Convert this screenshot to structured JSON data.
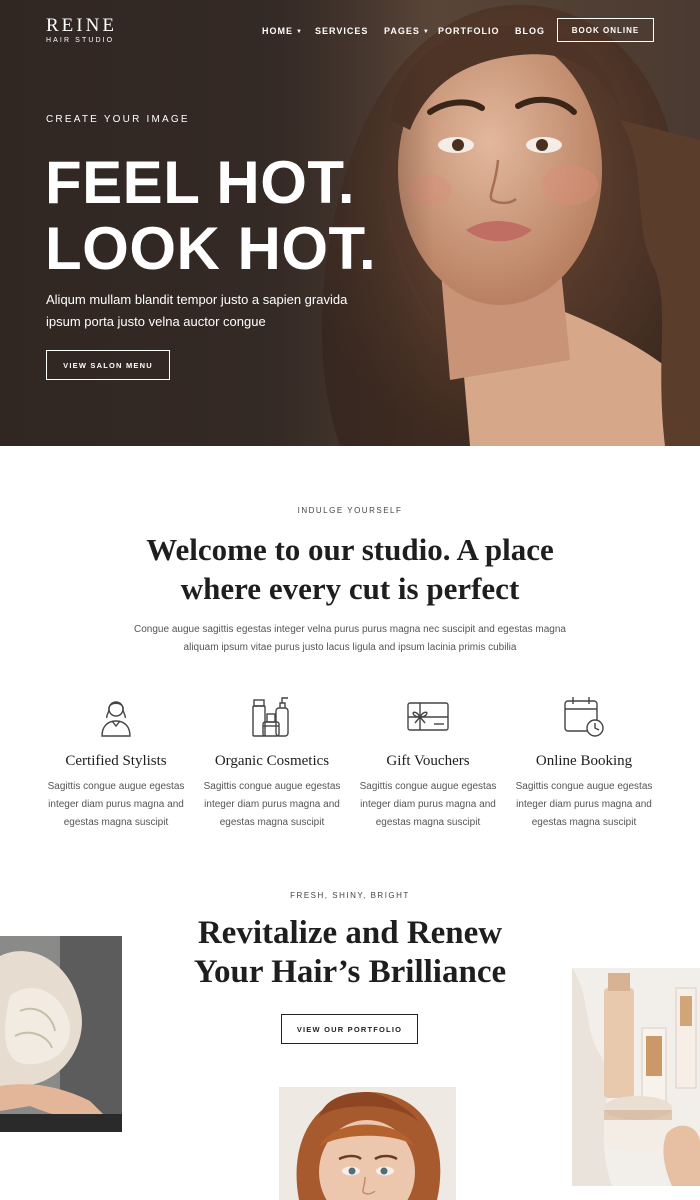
{
  "header": {
    "logo": {
      "name": "REINE",
      "tagline": "HAIR STUDIO"
    },
    "nav": [
      {
        "label": "HOME",
        "has_dropdown": true
      },
      {
        "label": "SERVICES",
        "has_dropdown": false
      },
      {
        "label": "PAGES",
        "has_dropdown": true
      },
      {
        "label": "PORTFOLIO",
        "has_dropdown": false
      },
      {
        "label": "BLOG",
        "has_dropdown": false
      }
    ],
    "cta": "BOOK ONLINE"
  },
  "hero": {
    "eyebrow": "CREATE YOUR IMAGE",
    "title_line1": "FEEL HOT.",
    "title_line2": "LOOK HOT.",
    "text": "Aliqum mullam blandit tempor justo a sapien gravida ipsum porta justo velna auctor congue",
    "button": "VIEW SALON MENU"
  },
  "welcome": {
    "eyebrow": "INDULGE YOURSELF",
    "title_line1": "Welcome to our studio. A place",
    "title_line2": "where every cut is perfect",
    "text": "Congue augue sagittis egestas integer velna purus purus magna nec suscipit and egestas magna aliquam ipsum vitae purus justo lacus ligula and ipsum lacinia primis cubilia"
  },
  "features": [
    {
      "icon": "stylist-icon",
      "title": "Certified Stylists",
      "text": "Sagittis congue augue egestas integer diam purus magna and egestas magna suscipit"
    },
    {
      "icon": "cosmetics-icon",
      "title": "Organic Cosmetics",
      "text": "Sagittis congue augue egestas integer diam purus magna and egestas magna suscipit"
    },
    {
      "icon": "gift-card-icon",
      "title": "Gift Vouchers",
      "text": "Sagittis congue augue egestas integer diam purus magna and egestas magna suscipit"
    },
    {
      "icon": "calendar-clock-icon",
      "title": "Online Booking",
      "text": "Sagittis congue augue egestas integer diam purus magna and egestas magna suscipit"
    }
  ],
  "revitalize": {
    "eyebrow": "FRESH, SHINY, BRIGHT",
    "title_line1": "Revitalize and Renew",
    "title_line2": "Your Hair’s Brilliance",
    "button": "VIEW OUR PORTFOLIO"
  },
  "colors": {
    "hero_bg": "#43362f",
    "text_dark": "#1e1e1e",
    "text_muted": "#555555",
    "white": "#ffffff"
  }
}
